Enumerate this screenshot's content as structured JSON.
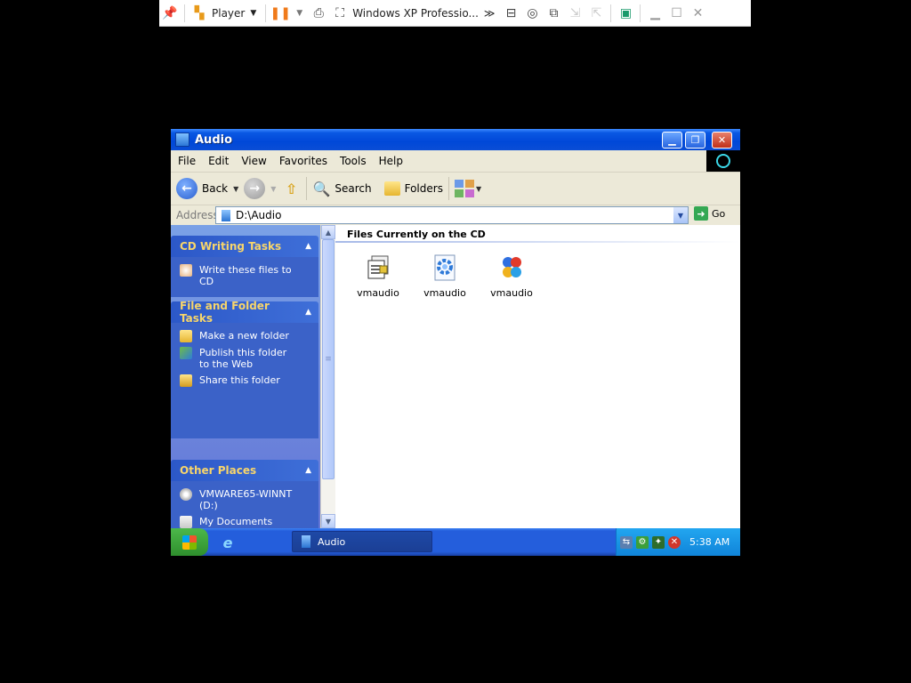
{
  "vm_toolbar": {
    "player_label": "Player",
    "vm_name": "Windows XP Professio...",
    "more_glyph": "≫"
  },
  "window": {
    "title": "Audio",
    "menu": [
      "File",
      "Edit",
      "View",
      "Favorites",
      "Tools",
      "Help"
    ],
    "toolbar": {
      "back_label": "Back",
      "search_label": "Search",
      "folders_label": "Folders"
    },
    "address": {
      "label": "Address",
      "value": "D:\\Audio",
      "go_label": "Go"
    }
  },
  "task_pane": {
    "cd_writing": {
      "title": "CD Writing Tasks",
      "tasks": [
        "Write these files to CD"
      ]
    },
    "file_folder": {
      "title": "File and Folder Tasks",
      "tasks": [
        "Make a new folder",
        "Publish this folder to the Web",
        "Share this folder"
      ]
    },
    "other_places": {
      "title": "Other Places",
      "items": [
        "VMWARE65-WINNT (D:)",
        "My Documents"
      ]
    }
  },
  "content": {
    "group_header": "Files Currently on the CD",
    "files": [
      {
        "name": "vmaudio",
        "icon": "setup-information-icon"
      },
      {
        "name": "vmaudio",
        "icon": "vmaudio-cat-icon"
      },
      {
        "name": "vmaudio",
        "icon": "vmaudio-driver-icon"
      }
    ]
  },
  "taskbar": {
    "task_button": "Audio",
    "clock": "5:38 AM"
  },
  "colors": {
    "title_blue": "#0a58e3",
    "taskpane_blue": "#3b62c8",
    "start_green": "#3c9f3a",
    "tray_blue": "#1084d9"
  }
}
